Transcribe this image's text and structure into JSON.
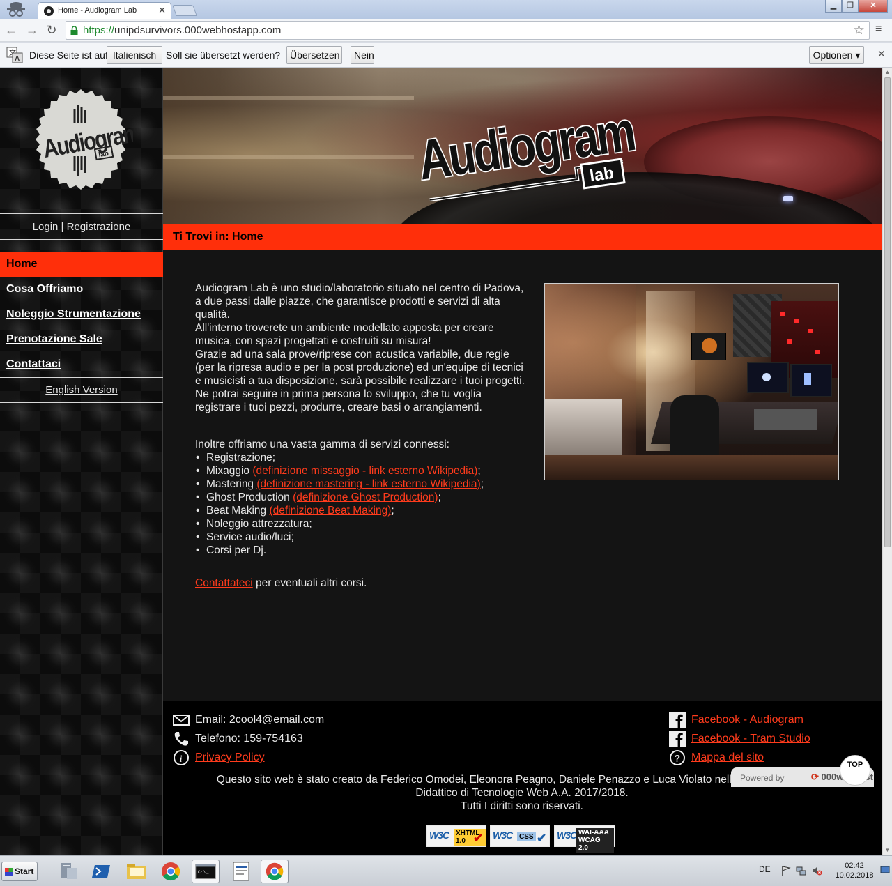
{
  "browser": {
    "tab_title": "Home - Audiogram Lab",
    "tab_close": "✕",
    "url_scheme": "https://",
    "url_rest": "unipdsurvivors.000webhostapp.com",
    "window_controls": {
      "minimize": "▁",
      "maximize": "❐",
      "close": "✕"
    },
    "nav": {
      "back": "←",
      "forward": "→",
      "reload": "↻"
    },
    "star_icon": "☆",
    "menu_icon": "≡"
  },
  "translate_bar": {
    "prompt_before": "Diese Seite ist auf",
    "language_select": "Italienisch ▾",
    "prompt_after": "Soll sie übersetzt werden?",
    "translate_button": "Übersetzen",
    "no_button": "Nein",
    "options_button": "Optionen ▾",
    "close": "✕"
  },
  "sidebar": {
    "login_link": "Login | Registrazione",
    "nav_items": [
      {
        "label": "Home",
        "active": true
      },
      {
        "label": "Cosa Offriamo",
        "active": false
      },
      {
        "label": "Noleggio Strumentazione",
        "active": false
      },
      {
        "label": "Prenotazione Sale",
        "active": false
      },
      {
        "label": "Contattaci",
        "active": false
      }
    ],
    "language_link": "English Version"
  },
  "logo": {
    "brand": "Audiogram",
    "sub": "lab"
  },
  "breadcrumb": {
    "text": "Ti Trovi in: Home"
  },
  "content": {
    "intro_paragraphs": [
      "Audiogram Lab è uno studio/laboratorio situato nel centro di Padova, a due passi dalle piazze, che garantisce prodotti e servizi di alta qualità.",
      "All'interno troverete un ambiente modellato apposta per creare musica, con spazi progettati e costruiti su misura!",
      "Grazie ad una sala prove/riprese con acustica variabile, due regie (per la ripresa audio e per la post produzione) ed un'equipe di tecnici e musicisti a tua disposizione, sarà possibile realizzare i tuoi progetti. Ne potrai seguire in prima persona lo sviluppo, che tu voglia registrare i tuoi pezzi, produrre, creare basi o arrangiamenti."
    ],
    "services_intro": "Inoltre offriamo una vasta gamma di servizi connessi:",
    "services": [
      {
        "text": "Registrazione;",
        "link": "",
        "after": ""
      },
      {
        "text": "Mixaggio ",
        "link": "(definizione missaggio - link esterno Wikipedia)",
        "after": ";"
      },
      {
        "text": "Mastering ",
        "link": "(definizione mastering - link esterno Wikipedia)",
        "after": ";"
      },
      {
        "text": "Ghost Production ",
        "link": "(definizione Ghost Production)",
        "after": ";"
      },
      {
        "text": "Beat Making ",
        "link": "(definizione Beat Making)",
        "after": ";"
      },
      {
        "text": "Noleggio attrezzatura;",
        "link": "",
        "after": ""
      },
      {
        "text": "Service audio/luci;",
        "link": "",
        "after": ""
      },
      {
        "text": "Corsi per Dj.",
        "link": "",
        "after": ""
      }
    ],
    "contact_link": "Contattateci",
    "contact_rest": " per eventuali altri corsi."
  },
  "footer": {
    "email_label": "Email: 2cool4@email.com",
    "phone_label": "Telefono: 159-754163",
    "privacy_link": "Privacy Policy",
    "facebook_audiogram": "Facebook - Audiogram",
    "facebook_tram": "Facebook - Tram Studio",
    "sitemap_link": "Mappa del sito",
    "credits_line1": "Questo sito web è stato creato da Federico Omodei, Eleonora Peagno, Daniele Penazzo e Luca Violato nell'ambito del Progetto",
    "credits_line2": "Didattico di Tecnologie Web A.A. 2017/2018.",
    "credits_line3": "Tutti I diritti sono riservati.",
    "badges": [
      {
        "logo": "W3C",
        "text": "XHTML 1.0"
      },
      {
        "logo": "W3C",
        "text": "CSS"
      },
      {
        "logo": "W3C",
        "text": "WAI-AAA WCAG 2.0"
      }
    ]
  },
  "hosting": {
    "powered_by": "Powered by",
    "brand": "000webhost",
    "top_button": "TOP"
  },
  "taskbar": {
    "start": "Start",
    "language": "DE",
    "time": "02:42",
    "date": "10.02.2018"
  },
  "colors": {
    "accent": "#ff2f0a",
    "link": "#ff3b1c",
    "page_bg": "#141414"
  }
}
